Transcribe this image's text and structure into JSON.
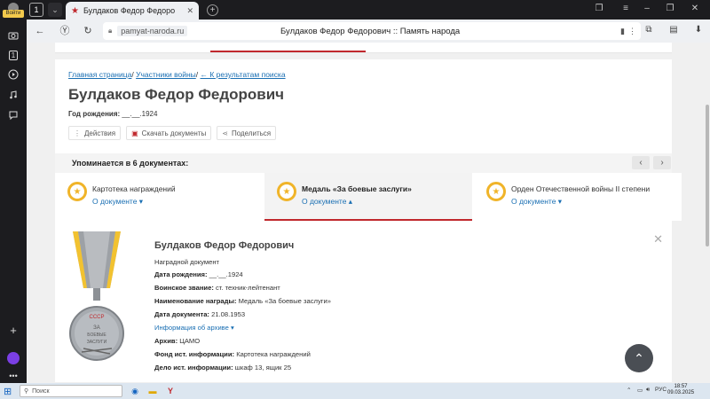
{
  "browser": {
    "login_label": "Войти",
    "tab_count": "1",
    "tab_title": "Булдаков Федор Федоро",
    "url_domain": "pamyat-naroda.ru",
    "url_page_title": "Булдаков Федор Федорович :: Память народа",
    "rail_number": "1"
  },
  "breadcrumb": {
    "home": "Главная страница",
    "participants": "Участники войны",
    "back": "← К результатам поиска"
  },
  "person": {
    "name": "Булдаков Федор Федорович",
    "birth_label": "Год рождения:",
    "birth_value": "__.__.1924"
  },
  "actions": {
    "actions_label": "Действия",
    "download_label": "Скачать документы",
    "share_label": "Поделиться"
  },
  "mentions": {
    "title": "Упоминается в 6 документах:"
  },
  "doc_tabs": [
    {
      "title": "Картотека награждений",
      "link": "О документе ▾"
    },
    {
      "title": "Медаль «За боевые заслуги»",
      "link": "О документе ▴"
    },
    {
      "title": "Орден Отечественной войны II степени",
      "link": "О документе ▾"
    }
  ],
  "detail": {
    "name": "Булдаков Федор Федорович",
    "doc_type": "Наградной документ",
    "birth_label": "Дата рождения:",
    "birth_value": "__.__.1924",
    "rank_label": "Воинское звание:",
    "rank_value": "ст. техник-лейтенант",
    "award_label": "Наименование награды:",
    "award_value": "Медаль «За боевые заслуги»",
    "date_label": "Дата документа:",
    "date_value": "21.08.1953",
    "archive_info": "Информация об архиве ▾",
    "archive_label": "Архив:",
    "archive_value": "ЦАМО",
    "fund_label": "Фонд ист. информации:",
    "fund_value": "Картотека награждений",
    "case_label": "Дело ист. информации:",
    "case_value": "шкаф 13, ящик 25",
    "medal_text_1": "ЗА",
    "medal_text_2": "БОЕВЫЕ",
    "medal_text_3": "ЗАСЛУГИ",
    "medal_top": "СССР"
  },
  "taskbar": {
    "search_placeholder": "Поиск",
    "lang": "РУС",
    "time": "18:57",
    "date": "09.03.2025"
  },
  "colors": {
    "accent_red": "#c0282d",
    "link_blue": "#1a6fb3",
    "medal_gold": "#f0b429"
  }
}
